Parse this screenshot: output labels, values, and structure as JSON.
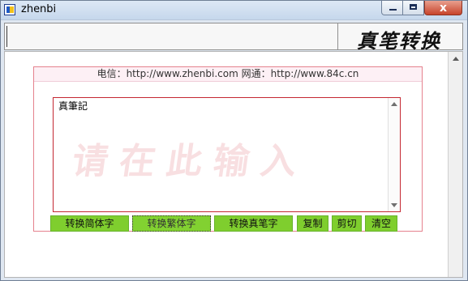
{
  "window": {
    "title": "zhenbi",
    "controls": {
      "minimize": "minimize",
      "maximize": "maximize",
      "close": "x"
    }
  },
  "toolbar": {
    "logo": "真笔转换"
  },
  "contact": {
    "text": "电信：http://www.zhenbi.com 网通：http://www.84c.cn"
  },
  "editor": {
    "value": "真筆記",
    "watermark": "请在此输入"
  },
  "buttons": {
    "simplified": "转换简体字",
    "traditional": "转换繁体字",
    "brush": "转换真笔字",
    "copy": "复制",
    "cut": "剪切",
    "clear": "清空"
  },
  "colors": {
    "accent_green": "#7fce2e",
    "border_red": "#c42832",
    "panel_pink": "#fdf0f5"
  },
  "icons": {
    "app": "app-icon",
    "scroll_up": "scroll-up-arrow-icon",
    "scroll_down": "scroll-down-arrow-icon"
  }
}
